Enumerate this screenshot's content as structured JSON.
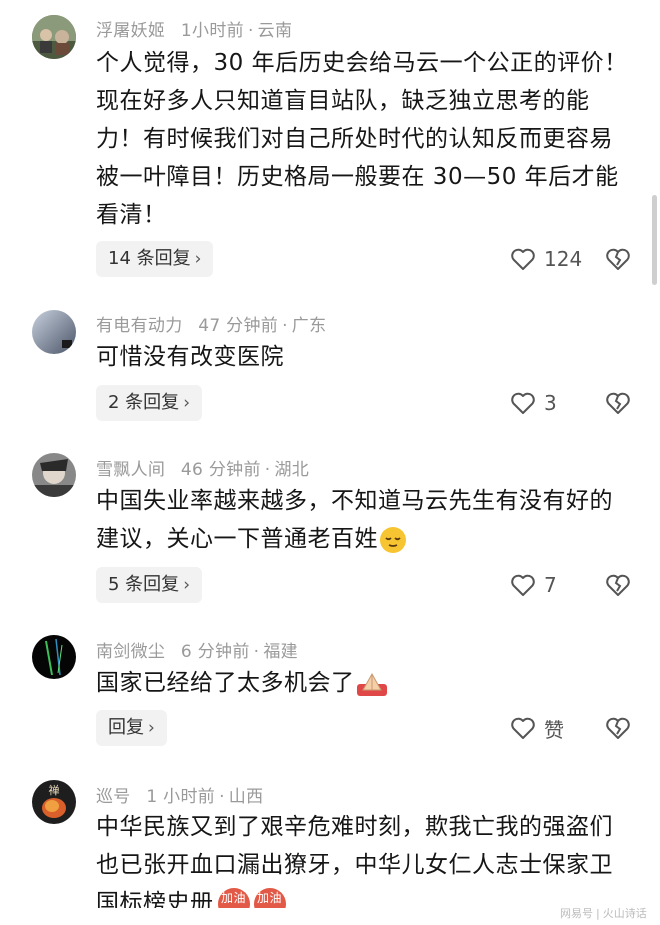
{
  "comments": [
    {
      "user": "浮屠妖姬",
      "time": "1小时前",
      "location": "云南",
      "text": "个人觉得，30 年后历史会给马云一个公正的评价！现在好多人只知道盲目站队，缺乏独立思考的能力！有时候我们对自己所处时代的认知反而更容易被一叶障目！历史格局一般要在 30—50 年后才能看清！",
      "reply_label": "14 条回复",
      "likes": "124",
      "avatar_color": "#5a6a4a"
    },
    {
      "user": "有电有动力",
      "time": "47 分钟前",
      "location": "广东",
      "text": "可惜没有改变医院",
      "reply_label": "2 条回复",
      "likes": "3",
      "avatar_color": "#7b8aa0"
    },
    {
      "user": "雪飘人间",
      "time": "46 分钟前",
      "location": "湖北",
      "text": "中国失业率越来越多，不知道马云先生有没有好的建议，关心一下普通老百姓",
      "reply_label": "5 条回复",
      "likes": "7",
      "avatar_color": "#555555"
    },
    {
      "user": "南剑微尘",
      "time": "6 分钟前",
      "location": "福建",
      "text": "国家已经给了太多机会了",
      "reply_label": "回复",
      "likes": "赞",
      "avatar_color": "#0a0a0a"
    },
    {
      "user": "巡号",
      "time": "1 小时前",
      "location": "山西",
      "text": "中华民族又到了艰辛危难时刻，欺我亡我的强盗们也已张开血口漏出獠牙，中华儿女仁人志士保家卫国标榜史册",
      "avatar_color": "#2a2a2a",
      "avatar_text": "禅",
      "badge_text": "加油"
    }
  ],
  "watermark": {
    "left": "网易号",
    "right": "火山诗话"
  },
  "colors": {
    "meta": "#9a9a9a",
    "text": "#161616",
    "reply_bg": "#f2f2f2"
  }
}
